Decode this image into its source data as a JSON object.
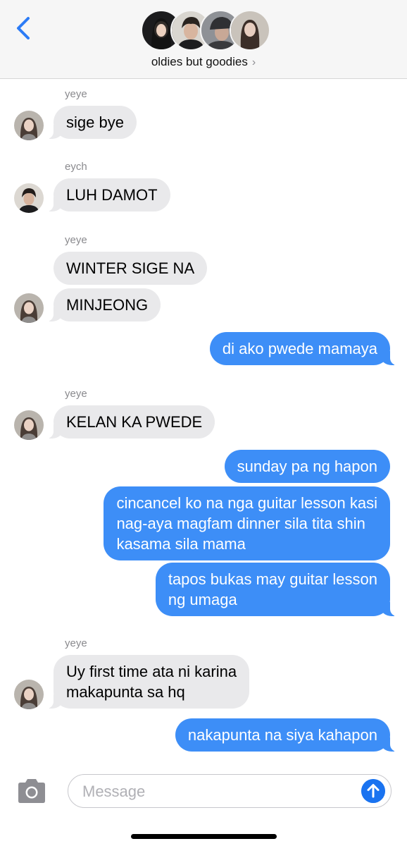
{
  "header": {
    "back_icon": "chevron-left-icon",
    "group_name": "oldies but goodies",
    "chevron": "›",
    "accent_color": "#2c7cf6"
  },
  "messages": {
    "m1": {
      "sender": "yeye",
      "text": "sige bye"
    },
    "m2": {
      "sender": "eych",
      "text": "LUH DAMOT"
    },
    "m3": {
      "sender": "yeye",
      "text": "WINTER SIGE NA"
    },
    "m4": {
      "text": "MINJEONG"
    },
    "m5": {
      "text": "di ako pwede mamaya"
    },
    "m6": {
      "sender": "yeye",
      "text": "KELAN KA PWEDE"
    },
    "m7": {
      "text": "sunday pa ng hapon"
    },
    "m8": {
      "line1": "cincancel ko na nga guitar lesson kasi",
      "line2": "nag-aya magfam dinner sila tita shin",
      "line3": "kasama sila mama"
    },
    "m9": {
      "line1": "tapos bukas may guitar lesson",
      "line2": "ng umaga"
    },
    "m10": {
      "sender": "yeye",
      "line1": "Uy first time ata ni karina",
      "line2": "makapunta sa hq"
    },
    "m11": {
      "text": "nakapunta na siya kahapon"
    }
  },
  "composer": {
    "placeholder": "Message",
    "camera_icon": "camera-icon",
    "send_icon": "arrow-up-icon"
  },
  "colors": {
    "outgoing": "#3d8ef7",
    "incoming": "#e9e9eb"
  }
}
